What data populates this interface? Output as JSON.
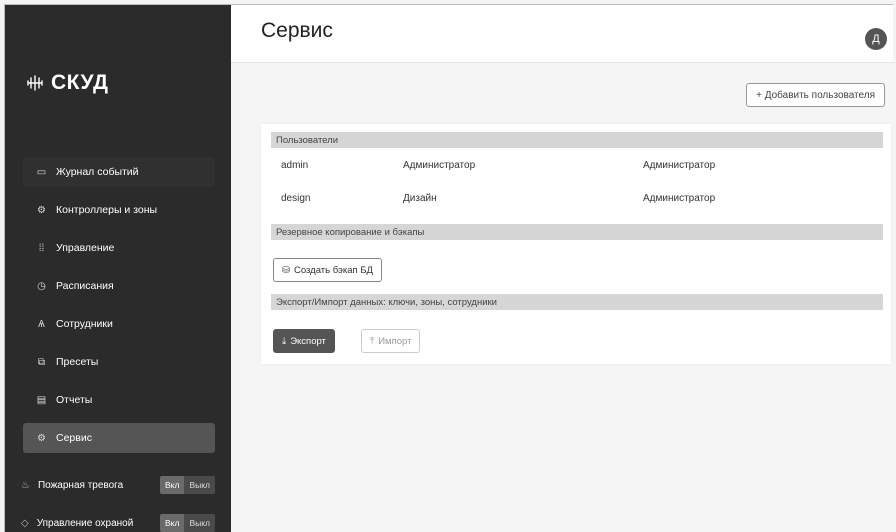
{
  "app": {
    "logo_text": "СКУД"
  },
  "sidebar": {
    "items": [
      {
        "label": "Журнал событий",
        "icon": "monitor-icon"
      },
      {
        "label": "Контроллеры и зоны",
        "icon": "controller-icon"
      },
      {
        "label": "Управление",
        "icon": "sliders-icon"
      },
      {
        "label": "Расписания",
        "icon": "clock-icon"
      },
      {
        "label": "Сотрудники",
        "icon": "users-icon"
      },
      {
        "label": "Пресеты",
        "icon": "preset-icon"
      },
      {
        "label": "Отчеты",
        "icon": "report-icon"
      },
      {
        "label": "Сервис",
        "icon": "gear-icon"
      }
    ],
    "active_item": "Сервис",
    "fire_alarm": {
      "label": "Пожарная тревога",
      "on": "Вкл",
      "off": "Выкл"
    },
    "security": {
      "label": "Управление охраной",
      "on": "Вкл",
      "off": "Выкл"
    }
  },
  "header": {
    "title": "Сервис",
    "avatar_letter": "Д"
  },
  "toolbar": {
    "add_user_label": "+ Добавить пользователя"
  },
  "users_section": {
    "title": "Пользователи",
    "rows": [
      {
        "login": "admin",
        "name": "Администратор",
        "role": "Администратор"
      },
      {
        "login": "design",
        "name": "Дизайн",
        "role": "Администратор"
      }
    ]
  },
  "backup_section": {
    "title": "Резервное копирование и бэкапы",
    "button_label": "Создать бэкап БД"
  },
  "export_section": {
    "title": "Экспорт/Импорт данных: ключи, зоны, сотрудники",
    "export_label": "Экспорт",
    "import_label": "Импорт"
  }
}
